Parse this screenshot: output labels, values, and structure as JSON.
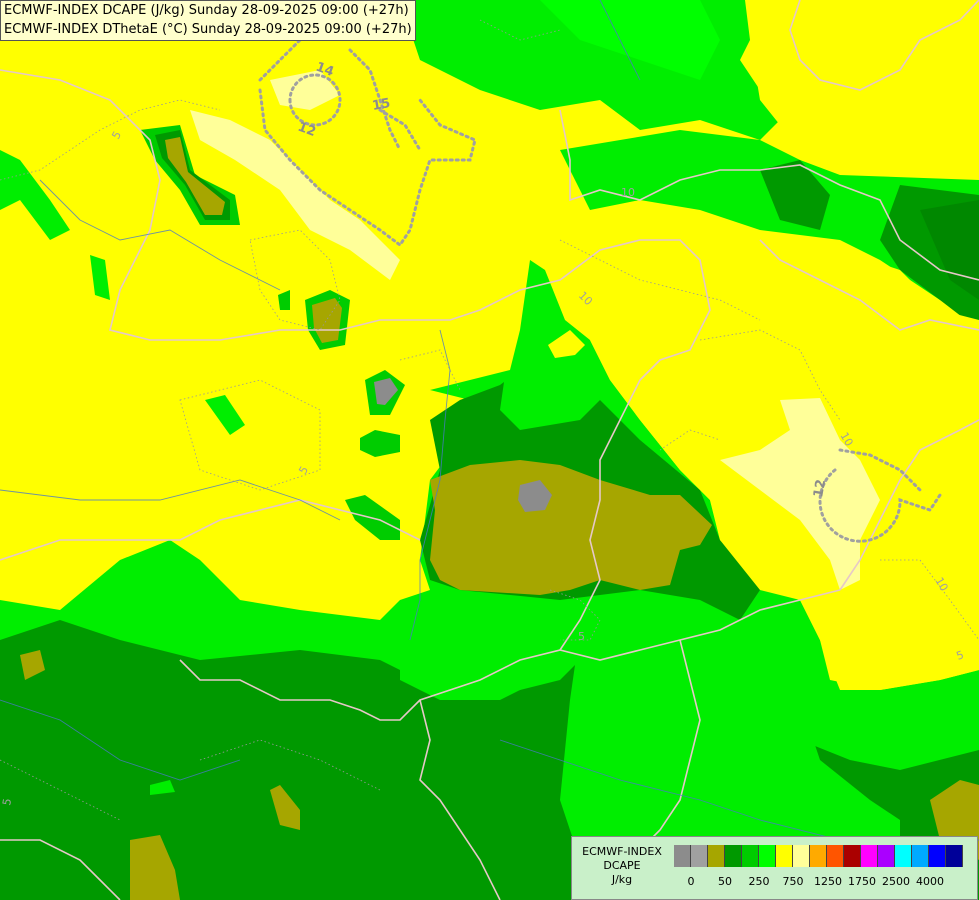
{
  "title_lines": [
    "ECMWF-INDEX DCAPE (J/kg) Sunday 28-09-2025 09:00 (+27h)",
    "ECMWF-INDEX DThetaE (°C) Sunday 28-09-2025 09:00 (+27h)"
  ],
  "legend": {
    "line1": "ECMWF-INDEX",
    "line2": "DCAPE",
    "line3": "J/kg",
    "colors": [
      "#8c8c8c",
      "#a0a0a0",
      "#a6a600",
      "#009900",
      "#00cc00",
      "#00ff00",
      "#ffff00",
      "#ffff99",
      "#ffaa00",
      "#ff5500",
      "#aa0000",
      "#ff00ff",
      "#aa00ff",
      "#00ffff",
      "#00aaff",
      "#0000ff",
      "#000099"
    ],
    "tick_labels": [
      "0",
      "50",
      "250",
      "750",
      "1250",
      "1750",
      "2500",
      "4000"
    ]
  },
  "contour_labels": [
    "5",
    "14",
    "15",
    "12",
    "10",
    "10",
    "5",
    "10",
    "12",
    "10",
    "5",
    "5",
    "5",
    "5"
  ]
}
